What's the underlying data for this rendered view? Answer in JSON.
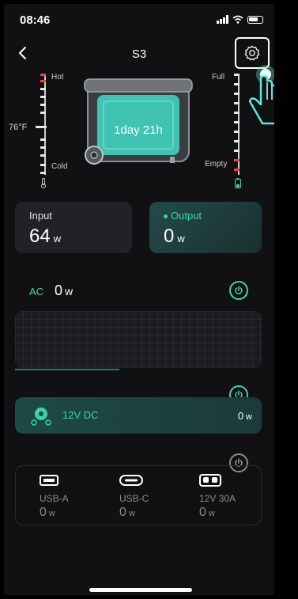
{
  "status": {
    "time": "08:46"
  },
  "nav": {
    "title": "S3"
  },
  "temperature": {
    "hot_label": "Hot",
    "cold_label": "Cold",
    "current": "76°F"
  },
  "battery": {
    "full_label": "Full",
    "empty_label": "Empty"
  },
  "device": {
    "remaining_time": "1day 21h"
  },
  "input": {
    "label": "Input",
    "value": "64",
    "unit": "w"
  },
  "output": {
    "label": "Output",
    "value": "0",
    "unit": "w"
  },
  "ac": {
    "label": "AC",
    "value": "0",
    "unit": "w"
  },
  "dc": {
    "label": "12V DC",
    "value": "0",
    "unit": "w"
  },
  "ports": [
    {
      "name": "USB-A",
      "value": "0",
      "unit": "w",
      "icon": "usb-a-icon"
    },
    {
      "name": "USB-C",
      "value": "0",
      "unit": "w",
      "icon": "usb-c-icon"
    },
    {
      "name": "12V 30A",
      "value": "0",
      "unit": "w",
      "icon": "12v-30a-port-icon"
    }
  ],
  "colors": {
    "accent": "#3bd6a4",
    "background": "#111113",
    "card": "#222226"
  }
}
